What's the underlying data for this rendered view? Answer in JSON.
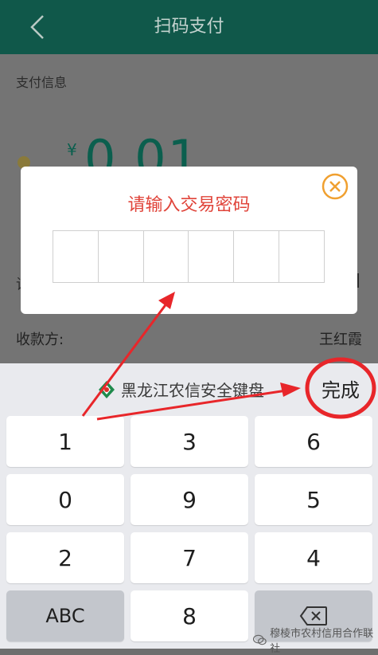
{
  "header": {
    "title": "扫码支付"
  },
  "payment": {
    "section_label": "支付信息",
    "currency": "¥",
    "amount": "0.01",
    "left_stub": "请",
    "payee_label": "收款方:",
    "payee_name": "王红霞"
  },
  "dialog": {
    "title": "请输入交易密码",
    "pin_length": 6
  },
  "keyboard": {
    "brand": "黑龙江农信安全键盘",
    "done_label": "完成",
    "rows": [
      [
        "1",
        "3",
        "6"
      ],
      [
        "0",
        "9",
        "5"
      ],
      [
        "2",
        "7",
        "4"
      ],
      [
        "ABC",
        "8",
        ""
      ]
    ]
  },
  "watermark": {
    "text": "穆棱市农村信用合作联社"
  },
  "colors": {
    "header_bg": "#10584a",
    "accent_red": "#e0443a",
    "dialog_close": "#f0a030",
    "amount": "#0b5f4e"
  }
}
